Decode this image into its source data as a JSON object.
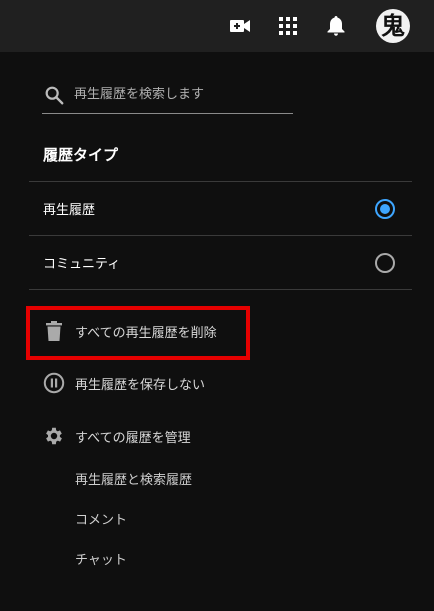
{
  "topbar": {
    "create_icon": "video-camera-plus-icon",
    "apps_icon": "apps-grid-icon",
    "notifications_icon": "bell-icon",
    "avatar_glyph": "鬼"
  },
  "search": {
    "placeholder": "再生履歴を検索します"
  },
  "history_type": {
    "title": "履歴タイプ",
    "options": [
      {
        "label": "再生履歴",
        "selected": true
      },
      {
        "label": "コミュニティ",
        "selected": false
      }
    ]
  },
  "actions": {
    "clear_all": "すべての再生履歴を削除",
    "pause": "再生履歴を保存しない",
    "manage": "すべての履歴を管理"
  },
  "manage_items": [
    "再生履歴と検索履歴",
    "コメント",
    "チャット"
  ],
  "colors": {
    "accent": "#3ea6ff",
    "highlight": "#e60000",
    "background": "#0f0f0f",
    "topbar": "#202020"
  }
}
